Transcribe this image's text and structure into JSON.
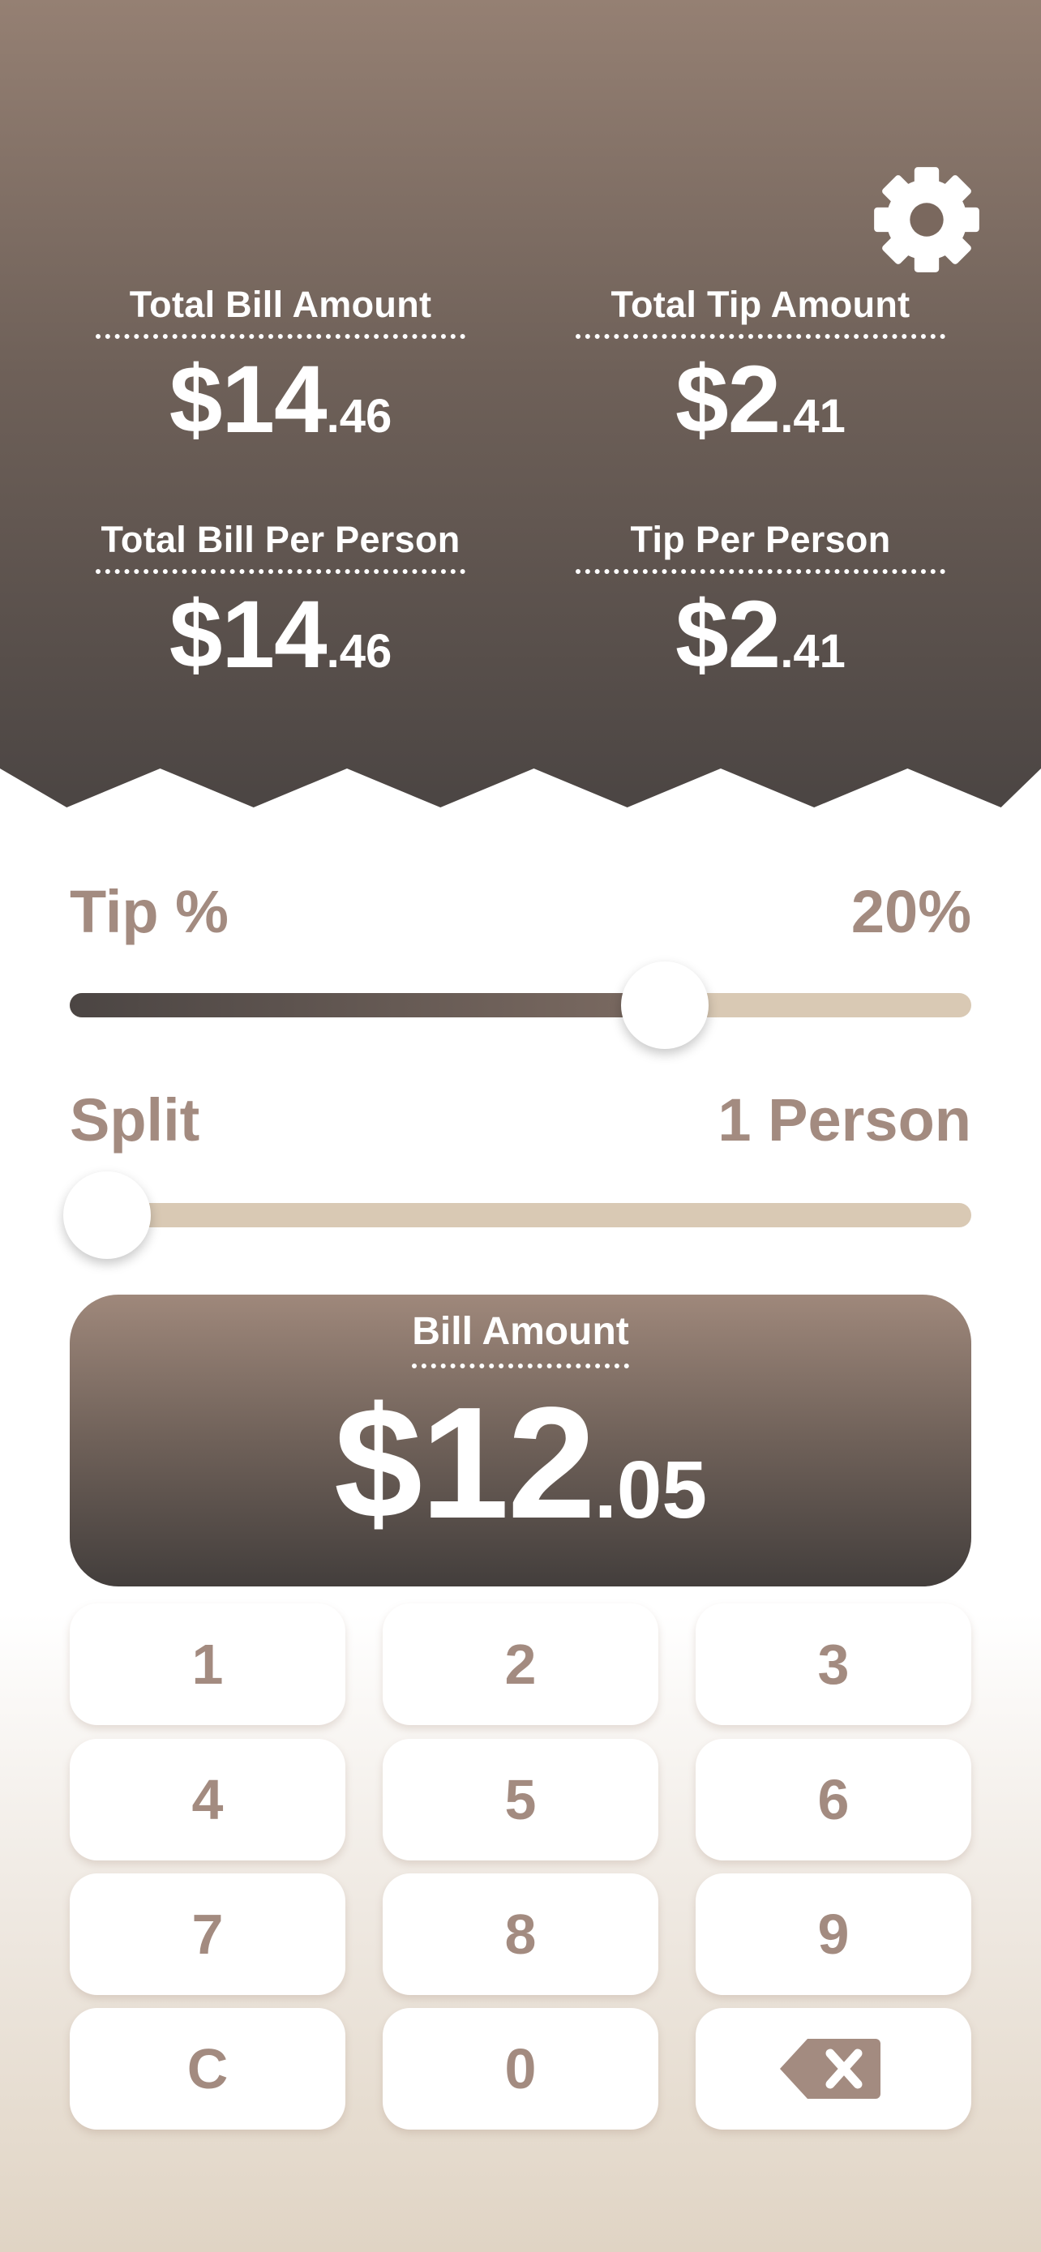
{
  "colors": {
    "accent_text": "#a38b80",
    "track": "#d9c9b4",
    "header_top": "#958073",
    "header_bottom": "#4b4543"
  },
  "header": {
    "settings_icon": "gear-icon",
    "total_bill": {
      "label": "Total Bill Amount",
      "whole": "$14",
      "cents": ".46"
    },
    "total_tip": {
      "label": "Total Tip Amount",
      "whole": "$2",
      "cents": ".41"
    },
    "bill_per_person": {
      "label": "Total Bill Per Person",
      "whole": "$14",
      "cents": ".46"
    },
    "tip_per_person": {
      "label": "Tip Per Person",
      "whole": "$2",
      "cents": ".41"
    }
  },
  "tip": {
    "label": "Tip %",
    "value": "20%",
    "slider_fraction": 0.66
  },
  "split": {
    "label": "Split",
    "value": "1 Person",
    "slider_fraction": 0.0
  },
  "bill": {
    "label": "Bill Amount",
    "whole": "$12",
    "cents": ".05"
  },
  "keypad": {
    "keys": [
      "1",
      "2",
      "3",
      "4",
      "5",
      "6",
      "7",
      "8",
      "9",
      "C",
      "0"
    ],
    "backspace_icon": "backspace-icon"
  }
}
